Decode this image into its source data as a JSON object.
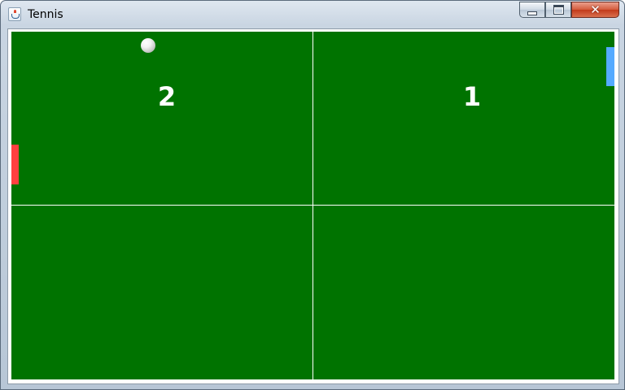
{
  "window": {
    "title": "Tennis",
    "icon": "java-cup-icon",
    "controls": {
      "minimize_icon": "minimize-icon",
      "maximize_icon": "maximize-icon",
      "close_glyph": "✕"
    }
  },
  "game": {
    "score_left": "2",
    "score_right": "1",
    "colors": {
      "court": "#007300",
      "lines": "#ffffff",
      "paddle_left": "#ff4040",
      "paddle_right": "#55aaff",
      "ball": "#f2f2f2"
    }
  }
}
